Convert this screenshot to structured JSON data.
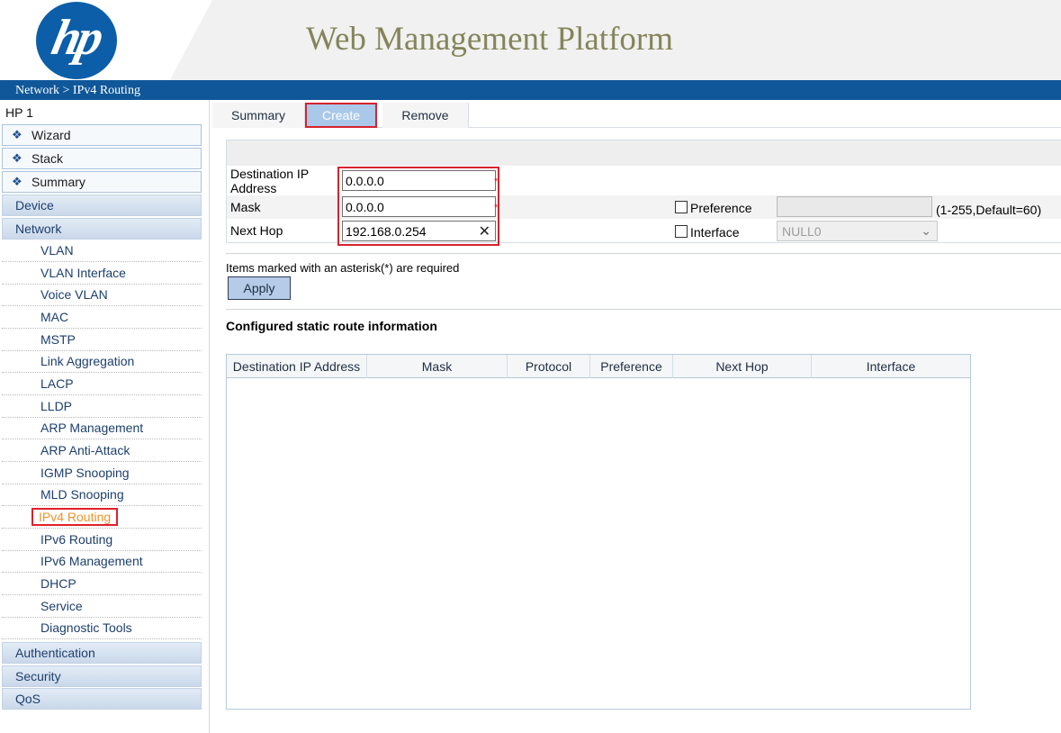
{
  "header": {
    "logo_text": "hp",
    "title": "Web Management Platform",
    "breadcrumb": "Network > IPv4 Routing"
  },
  "sidebar": {
    "device_name": "HP 1",
    "quick_items": [
      "Wizard",
      "Stack",
      "Summary"
    ],
    "groups_top": [
      "Device",
      "Network"
    ],
    "network_items": [
      "VLAN",
      "VLAN Interface",
      "Voice VLAN",
      "MAC",
      "MSTP",
      "Link Aggregation",
      "LACP",
      "LLDP",
      "ARP Management",
      "ARP Anti-Attack",
      "IGMP Snooping",
      "MLD Snooping",
      "IPv4 Routing",
      "IPv6 Routing",
      "IPv6 Management",
      "DHCP",
      "Service",
      "Diagnostic Tools"
    ],
    "active_item": "IPv4 Routing",
    "groups_bottom": [
      "Authentication",
      "Security",
      "QoS"
    ]
  },
  "tabs": {
    "summary": "Summary",
    "create": "Create",
    "remove": "Remove",
    "active": "Create"
  },
  "form": {
    "dest_label": "Destination IP Address",
    "dest_value": "0.0.0.0",
    "mask_label": "Mask",
    "mask_value": "0.0.0.0",
    "nexthop_label": "Next Hop",
    "nexthop_value": "192.168.0.254",
    "required_mark": "*",
    "preference_label": "Preference",
    "preference_value": "",
    "preference_hint": "(1-255,Default=60)",
    "interface_label": "Interface",
    "interface_value": "NULL0",
    "required_note": "Items marked with an asterisk(*) are required",
    "apply_label": "Apply"
  },
  "routes": {
    "title": "Configured static route information",
    "columns": [
      "Destination IP Address",
      "Mask",
      "Protocol",
      "Preference",
      "Next Hop",
      "Interface"
    ],
    "rows": []
  },
  "colors": {
    "brand_blue": "#0f5799",
    "highlight_red": "#d8232d",
    "active_nav": "#f0922a"
  }
}
